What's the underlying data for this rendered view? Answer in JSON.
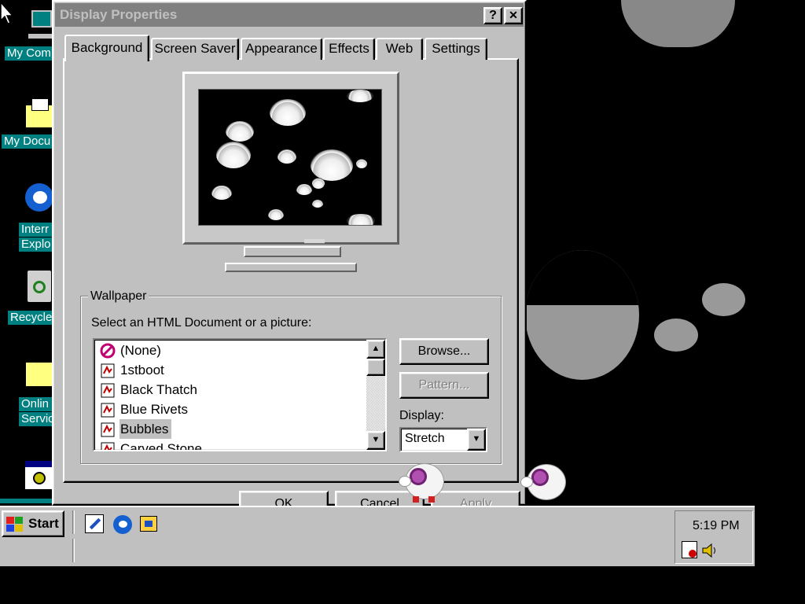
{
  "desktop": {
    "icons": [
      {
        "name": "my-computer",
        "label": "My Com"
      },
      {
        "name": "my-documents",
        "label": "My Docu"
      },
      {
        "name": "internet-explorer",
        "label1": "Interr",
        "label2": "Explo"
      },
      {
        "name": "recycle-bin",
        "label": "Recycle"
      },
      {
        "name": "online-services",
        "label1": "Onlin",
        "label2": "Servic"
      }
    ]
  },
  "dialog": {
    "title": "Display Properties",
    "help_label": "?",
    "close_label": "✕",
    "tabs": [
      "Background",
      "Screen Saver",
      "Appearance",
      "Effects",
      "Web",
      "Settings"
    ],
    "active_tab": "Background",
    "wallpaper": {
      "group_label": "Wallpaper",
      "select_label": "Select an HTML Document or a picture:",
      "items": [
        "(None)",
        "1stboot",
        "Black Thatch",
        "Blue Rivets",
        "Bubbles",
        "Carved Stone"
      ],
      "selected": "Bubbles",
      "browse_label": "Browse...",
      "pattern_label": "Pattern...",
      "display_label": "Display:",
      "display_value": "Stretch"
    },
    "buttons": {
      "ok": "OK",
      "cancel": "Cancel",
      "apply": "Apply"
    }
  },
  "taskbar": {
    "start_label": "Start",
    "quicklaunch": [
      "edit-icon",
      "ie-icon",
      "channels-icon"
    ],
    "clock": "5:19 PM"
  },
  "colors": {
    "desktop_teal": "#008080",
    "window_gray": "#c0c0c0",
    "title_inactive": "#808080"
  }
}
